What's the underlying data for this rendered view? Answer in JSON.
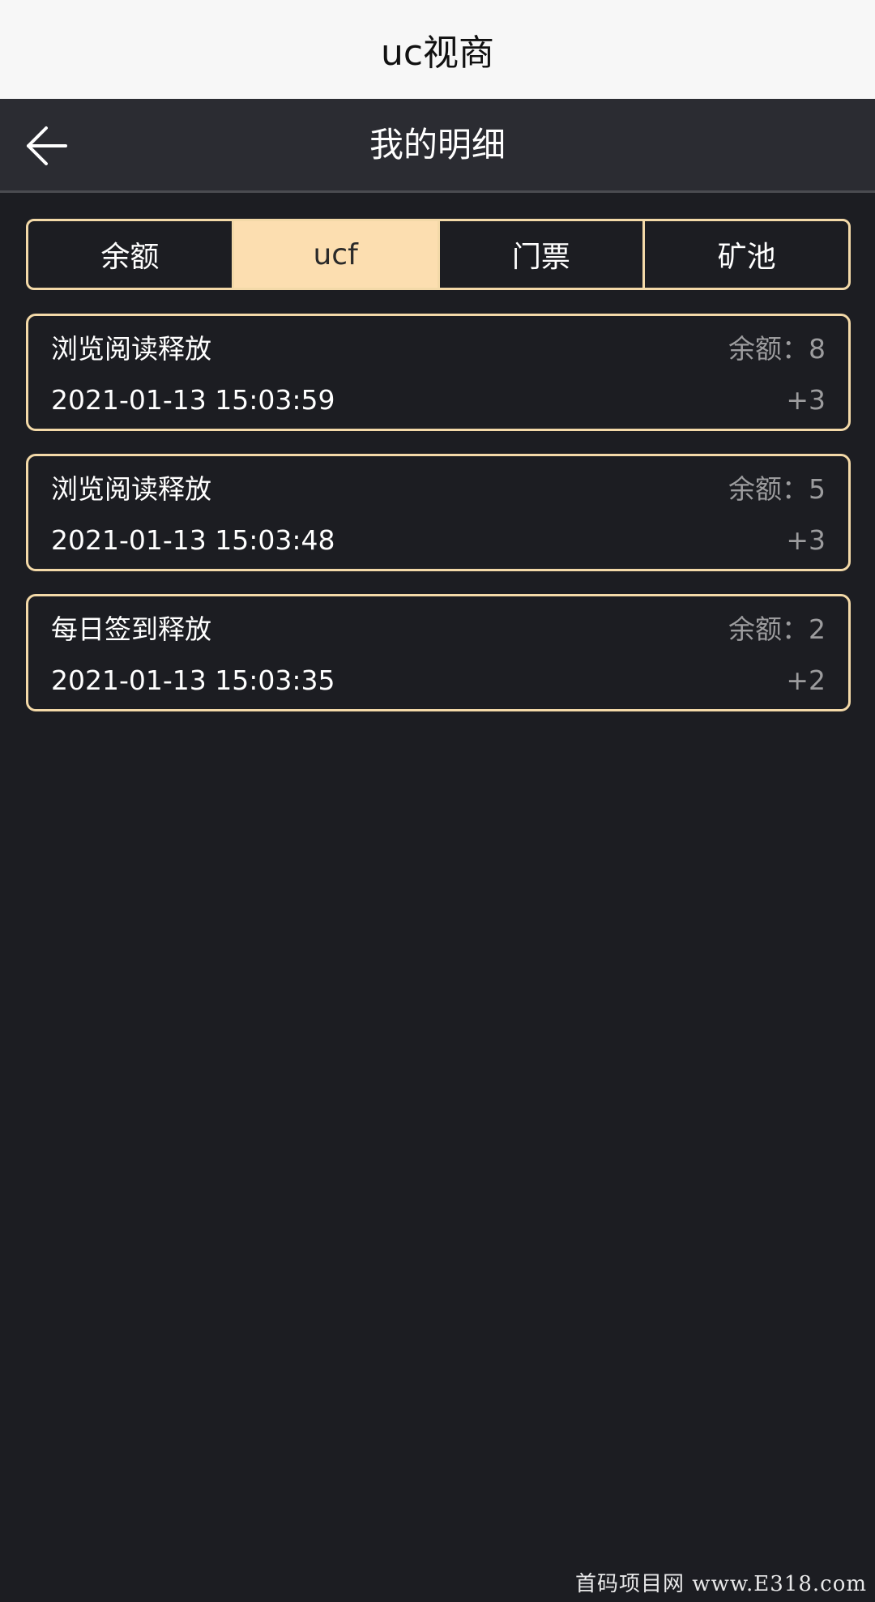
{
  "app": {
    "title": "uc视商"
  },
  "navbar": {
    "title": "我的明细",
    "back_icon": "arrow-left-icon"
  },
  "tabs": [
    {
      "label": "余额",
      "active": false
    },
    {
      "label": "ucf",
      "active": true
    },
    {
      "label": "门票",
      "active": false
    },
    {
      "label": "矿池",
      "active": false
    }
  ],
  "records": [
    {
      "title": "浏览阅读释放",
      "balance": "余额：8",
      "time": "2021-01-13 15:03:59",
      "amount": "+3"
    },
    {
      "title": "浏览阅读释放",
      "balance": "余额：5",
      "time": "2021-01-13 15:03:48",
      "amount": "+3"
    },
    {
      "title": "每日签到释放",
      "balance": "余额：2",
      "time": "2021-01-13 15:03:35",
      "amount": "+2"
    }
  ],
  "watermark": "首码项目网 www.E318.com",
  "colors": {
    "background": "#1c1d22",
    "navbar": "#2b2c32",
    "accent_border": "#f3d9a8",
    "active_tab": "#fcdeb0",
    "muted_text": "#9c9c9e"
  }
}
